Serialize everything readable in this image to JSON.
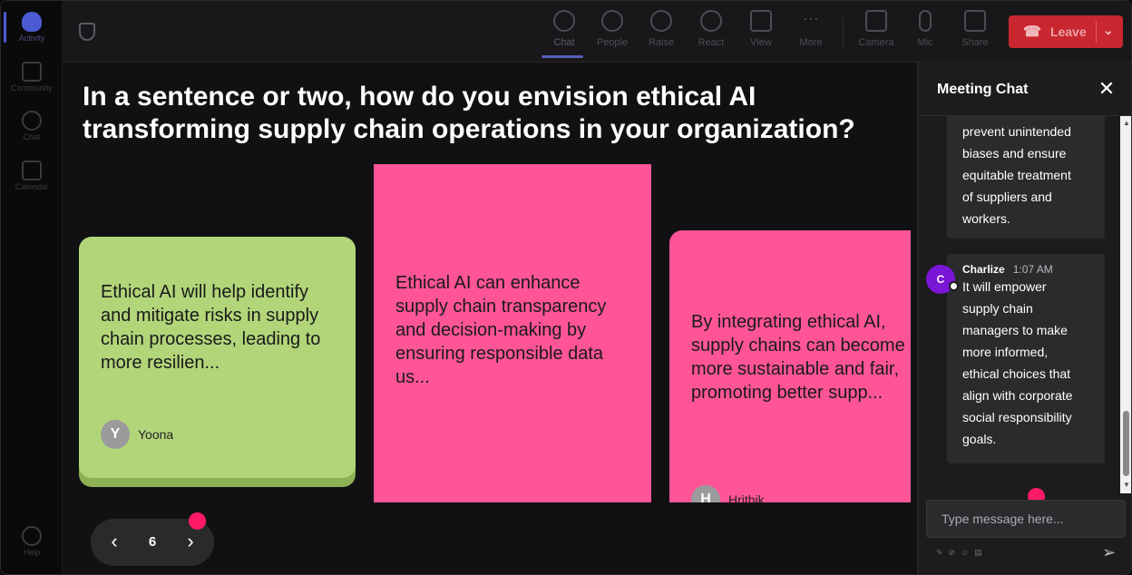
{
  "rail": {
    "items": [
      {
        "label": "Activity",
        "icon": "bell-icon"
      },
      {
        "label": "Community",
        "icon": "community-icon"
      },
      {
        "label": "Chat",
        "icon": "chat-icon"
      },
      {
        "label": "Calendar",
        "icon": "calendar-icon"
      },
      {
        "label": "Help",
        "icon": "help-icon"
      }
    ]
  },
  "toolbar": {
    "chat": "Chat",
    "people": "People",
    "raise": "Raise",
    "react": "React",
    "view": "View",
    "more": "More",
    "camera": "Camera",
    "mic": "Mic",
    "share": "Share",
    "leave": "Leave"
  },
  "stage": {
    "question": "In a sentence or two, how do you envision ethical AI transforming supply chain operations in your organization?",
    "cards": [
      {
        "text": "Ethical AI will help identify and mitigate risks in supply chain processes, leading to more resilien...",
        "author": "Yoona",
        "initial": "Y",
        "color": "#b2d57a"
      },
      {
        "text": "Ethical AI can enhance supply chain transparency and decision-making by ensuring responsible data us...",
        "color": "#ff5597"
      },
      {
        "text": "By integrating ethical AI, supply chains can become more sustainable and fair, promoting better supp...",
        "author": "Hrithik",
        "initial": "H",
        "color": "#ff5597"
      }
    ],
    "pager": {
      "page": "6"
    }
  },
  "chat": {
    "title": "Meeting Chat",
    "messages": [
      {
        "text_lines": [
          "prevent unintended",
          "biases and ensure",
          "equitable treatment",
          "of suppliers and",
          "workers."
        ]
      },
      {
        "sender": "Charlize",
        "initial": "C",
        "time": "1:07 AM",
        "text_lines": [
          "It will empower",
          "supply chain",
          "managers to make",
          "more informed,",
          "ethical choices that",
          "align with corporate",
          "social responsibility",
          "goals."
        ]
      }
    ],
    "input_placeholder": "Type message here..."
  },
  "colors": {
    "accent": "#4b5bd1",
    "leave": "#c9272f",
    "card_green": "#b2d57a",
    "card_pink": "#ff5597",
    "dot": "#ff1a66",
    "avatar_purple": "#7a16d6"
  }
}
